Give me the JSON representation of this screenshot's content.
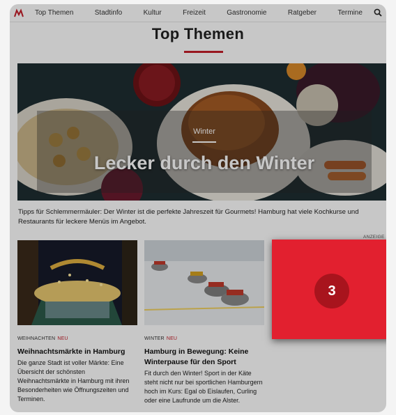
{
  "nav": {
    "items": [
      "Top Themen",
      "Stadtinfo",
      "Kultur",
      "Freizeit",
      "Gastronomie",
      "Ratgeber",
      "Termine"
    ]
  },
  "section": {
    "title": "Top Themen"
  },
  "hero": {
    "tag": "Winter",
    "headline": "Lecker durch den Winter",
    "caption": "Tipps für Schlemmermäuler: Der Winter ist die perfekte Jahreszeit für Gourmets! Hamburg hat viele Kochkurse und Restaurants für leckere Menüs im Angebot."
  },
  "ad": {
    "label": "ANZEIGE",
    "badge": "3"
  },
  "cards": [
    {
      "category": "WEIHNACHTEN",
      "badge": "NEU",
      "title": "Weihnachtsmärkte in Hamburg",
      "text": "Die ganze Stadt ist voller Märkte: Eine Übersicht der schönsten Weihnachtsmärkte in Hamburg mit ihren Besonderheiten wie Öffnungszeiten und Terminen."
    },
    {
      "category": "WINTER",
      "badge": "NEU",
      "title": "Hamburg in Bewegung: Keine Winterpause für den Sport",
      "text": "Fit durch den Winter! Sport in der Käte steht nicht nur bei sportlichen Hamburgern hoch im Kurs: Egal ob Eislaufen, Curling oder eine Laufrunde um die Alster."
    }
  ],
  "colors": {
    "brand_red": "#c41e2a",
    "ad_red": "#e2202f"
  }
}
